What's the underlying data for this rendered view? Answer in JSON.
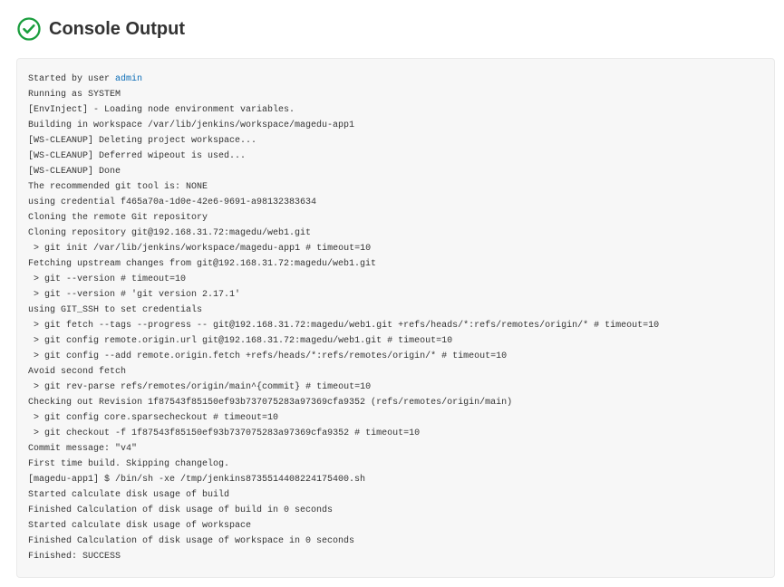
{
  "header": {
    "title": "Console Output",
    "status": "success",
    "icon_color": "#1b9e3e"
  },
  "console": {
    "prefix_text": "Started by user ",
    "user_link_text": "admin",
    "lines": "\nRunning as SYSTEM\n[EnvInject] - Loading node environment variables.\nBuilding in workspace /var/lib/jenkins/workspace/magedu-app1\n[WS-CLEANUP] Deleting project workspace...\n[WS-CLEANUP] Deferred wipeout is used...\n[WS-CLEANUP] Done\nThe recommended git tool is: NONE\nusing credential f465a70a-1d0e-42e6-9691-a98132383634\nCloning the remote Git repository\nCloning repository git@192.168.31.72:magedu/web1.git\n > git init /var/lib/jenkins/workspace/magedu-app1 # timeout=10\nFetching upstream changes from git@192.168.31.72:magedu/web1.git\n > git --version # timeout=10\n > git --version # 'git version 2.17.1'\nusing GIT_SSH to set credentials \n > git fetch --tags --progress -- git@192.168.31.72:magedu/web1.git +refs/heads/*:refs/remotes/origin/* # timeout=10\n > git config remote.origin.url git@192.168.31.72:magedu/web1.git # timeout=10\n > git config --add remote.origin.fetch +refs/heads/*:refs/remotes/origin/* # timeout=10\nAvoid second fetch\n > git rev-parse refs/remotes/origin/main^{commit} # timeout=10\nChecking out Revision 1f87543f85150ef93b737075283a97369cfa9352 (refs/remotes/origin/main)\n > git config core.sparsecheckout # timeout=10\n > git checkout -f 1f87543f85150ef93b737075283a97369cfa9352 # timeout=10\nCommit message: \"v4\"\nFirst time build. Skipping changelog.\n[magedu-app1] $ /bin/sh -xe /tmp/jenkins8735514408224175400.sh\nStarted calculate disk usage of build\nFinished Calculation of disk usage of build in 0 seconds\nStarted calculate disk usage of workspace\nFinished Calculation of disk usage of workspace in 0 seconds\nFinished: SUCCESS"
  }
}
